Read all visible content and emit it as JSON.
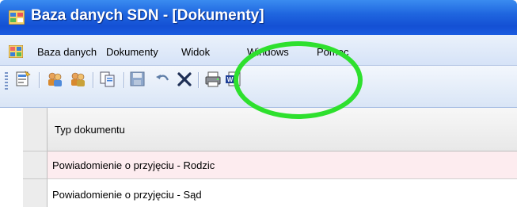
{
  "window": {
    "title": "Baza danych SDN - [Dokumenty]"
  },
  "menubar": {
    "items": [
      "Baza danych",
      "Dokumenty",
      "Widok",
      "Windows",
      "Pomoc"
    ]
  },
  "toolbar": {
    "icons": [
      "new-document-icon",
      "people-icon",
      "people-search-icon",
      "copy-icon",
      "save-icon",
      "undo-icon",
      "delete-icon",
      "print-icon",
      "word-export-icon"
    ]
  },
  "grid": {
    "column_header": "Typ dokumentu",
    "rows": [
      "Powiadomienie o przyjęciu - Rodzic",
      "Powiadomienie o przyjęciu - Sąd"
    ],
    "selected_row_color": "#fdecef"
  },
  "annotation": {
    "color": "#2ee02e"
  }
}
